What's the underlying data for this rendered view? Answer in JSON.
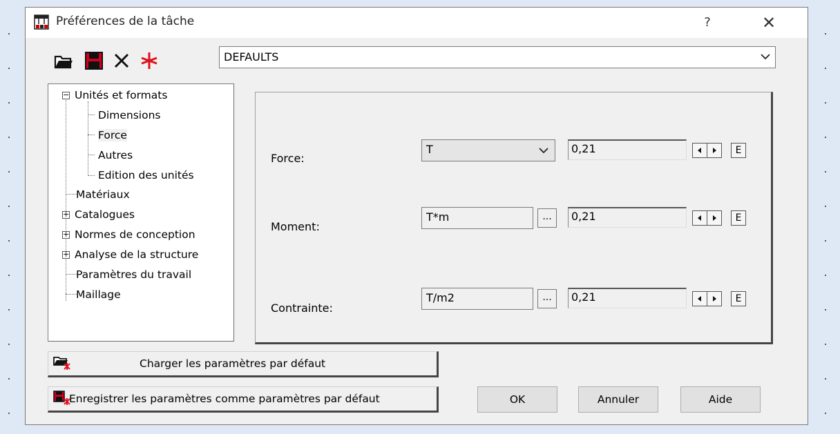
{
  "window": {
    "title": "Préférences de la tâche",
    "help_label": "?",
    "close_label": "✕"
  },
  "toolbar": {
    "icons": [
      "open-folder-icon",
      "save-icon",
      "delete-icon",
      "new-star-icon"
    ]
  },
  "profile": {
    "selected": "DEFAULTS"
  },
  "tree": {
    "items": [
      {
        "label": "Unités et formats",
        "expander": "−"
      },
      {
        "label": "Dimensions"
      },
      {
        "label": "Force"
      },
      {
        "label": "Autres"
      },
      {
        "label": "Edition des unités"
      },
      {
        "label": "Matériaux"
      },
      {
        "label": "Catalogues",
        "expander": "+"
      },
      {
        "label": "Normes de conception",
        "expander": "+"
      },
      {
        "label": "Analyse de la structure",
        "expander": "+"
      },
      {
        "label": "Paramètres du travail"
      },
      {
        "label": "Maillage"
      }
    ]
  },
  "units": {
    "rows": [
      {
        "label": "Force:",
        "unit": "T",
        "value": "0,21",
        "edit": "E"
      },
      {
        "label": "Moment:",
        "unit": "T*m",
        "browse": "...",
        "value": "0,21",
        "edit": "E"
      },
      {
        "label": "Contrainte:",
        "unit": "T/m2",
        "browse": "...",
        "value": "0,21",
        "edit": "E"
      }
    ]
  },
  "buttons": {
    "load_defaults": "Charger les paramètres par défaut",
    "save_defaults": "Enregistrer les paramètres comme paramètres par défaut",
    "ok": "OK",
    "cancel": "Annuler",
    "help": "Aide"
  }
}
